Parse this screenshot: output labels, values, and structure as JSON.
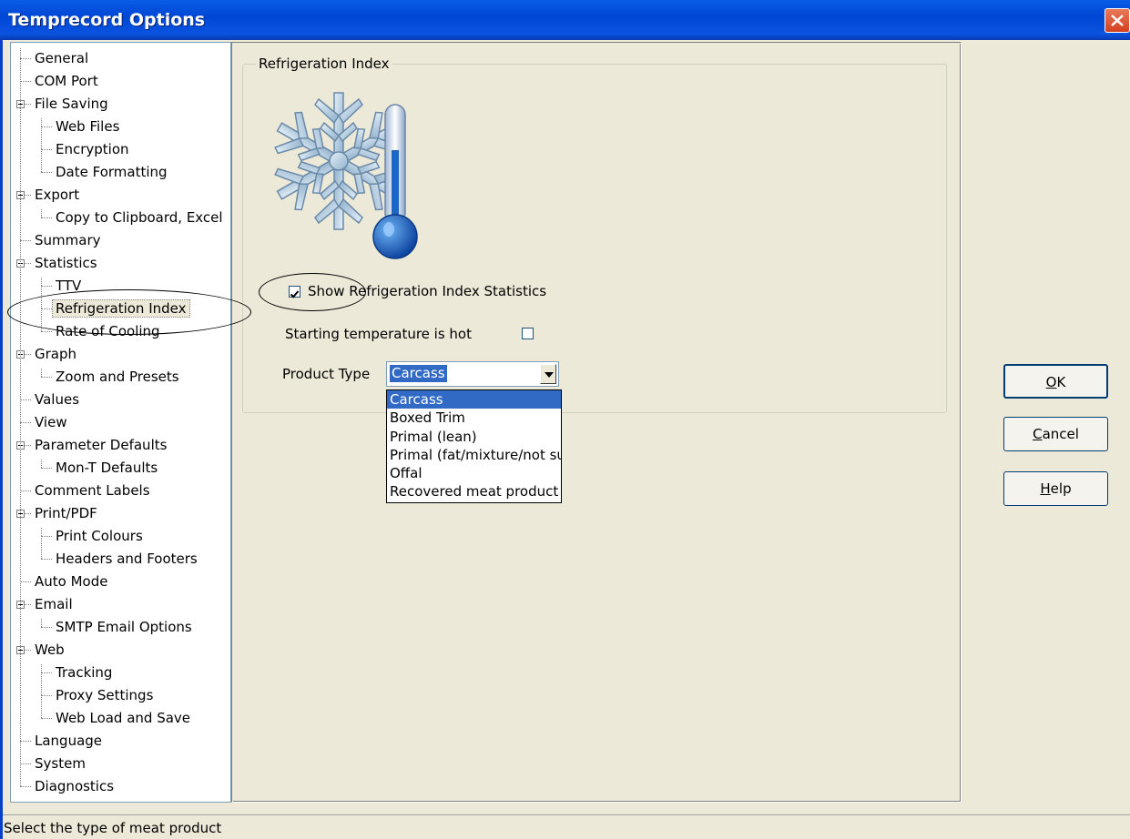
{
  "window": {
    "title": "Temprecord Options"
  },
  "tree": {
    "items": [
      {
        "label": "General",
        "level": 0
      },
      {
        "label": "COM Port",
        "level": 0
      },
      {
        "label": "File Saving",
        "level": 0,
        "expanded": true
      },
      {
        "label": "Web Files",
        "level": 1
      },
      {
        "label": "Encryption",
        "level": 1
      },
      {
        "label": "Date Formatting",
        "level": 1
      },
      {
        "label": "Export",
        "level": 0,
        "expanded": true
      },
      {
        "label": "Copy to Clipboard, Excel",
        "level": 1
      },
      {
        "label": "Summary",
        "level": 0
      },
      {
        "label": "Statistics",
        "level": 0,
        "expanded": true
      },
      {
        "label": "TTV",
        "level": 1
      },
      {
        "label": "Refrigeration Index",
        "level": 1,
        "selected": true
      },
      {
        "label": "Rate of Cooling",
        "level": 1
      },
      {
        "label": "Graph",
        "level": 0,
        "expanded": true
      },
      {
        "label": "Zoom and Presets",
        "level": 1
      },
      {
        "label": "Values",
        "level": 0
      },
      {
        "label": "View",
        "level": 0
      },
      {
        "label": "Parameter Defaults",
        "level": 0,
        "expanded": true
      },
      {
        "label": "Mon-T Defaults",
        "level": 1
      },
      {
        "label": "Comment Labels",
        "level": 0
      },
      {
        "label": "Print/PDF",
        "level": 0,
        "expanded": true
      },
      {
        "label": "Print Colours",
        "level": 1
      },
      {
        "label": "Headers and Footers",
        "level": 1
      },
      {
        "label": "Auto Mode",
        "level": 0
      },
      {
        "label": "Email",
        "level": 0,
        "expanded": true
      },
      {
        "label": "SMTP Email Options",
        "level": 1
      },
      {
        "label": "Web",
        "level": 0,
        "expanded": true
      },
      {
        "label": "Tracking",
        "level": 1
      },
      {
        "label": "Proxy Settings",
        "level": 1
      },
      {
        "label": "Web Load and Save",
        "level": 1
      },
      {
        "label": "Language",
        "level": 0
      },
      {
        "label": "System",
        "level": 0
      },
      {
        "label": "Diagnostics",
        "level": 0
      }
    ]
  },
  "panel": {
    "group_title": "Refrigeration Index",
    "icon": "snowflake-thermometer-icon",
    "show_stats": {
      "label": "Show Refrigeration Index Statistics",
      "checked": true
    },
    "starting_hot": {
      "label": "Starting temperature is hot",
      "checked": false
    },
    "product_type": {
      "label": "Product Type",
      "value": "Carcass",
      "options": [
        "Carcass",
        "Boxed Trim",
        "Primal (lean)",
        "Primal (fat/mixture/not su",
        "Offal",
        "Recovered meat product"
      ]
    }
  },
  "buttons": {
    "ok": {
      "pre": "",
      "key": "O",
      "post": "K"
    },
    "cancel": {
      "pre": "",
      "key": "C",
      "post": "ancel"
    },
    "help": {
      "pre": "",
      "key": "H",
      "post": "elp"
    }
  },
  "status": {
    "text": "Select the type of meat product"
  },
  "colors": {
    "title_bar": "#0046d5",
    "selection": "#316ac5",
    "dialog_bg": "#ece9d8"
  }
}
